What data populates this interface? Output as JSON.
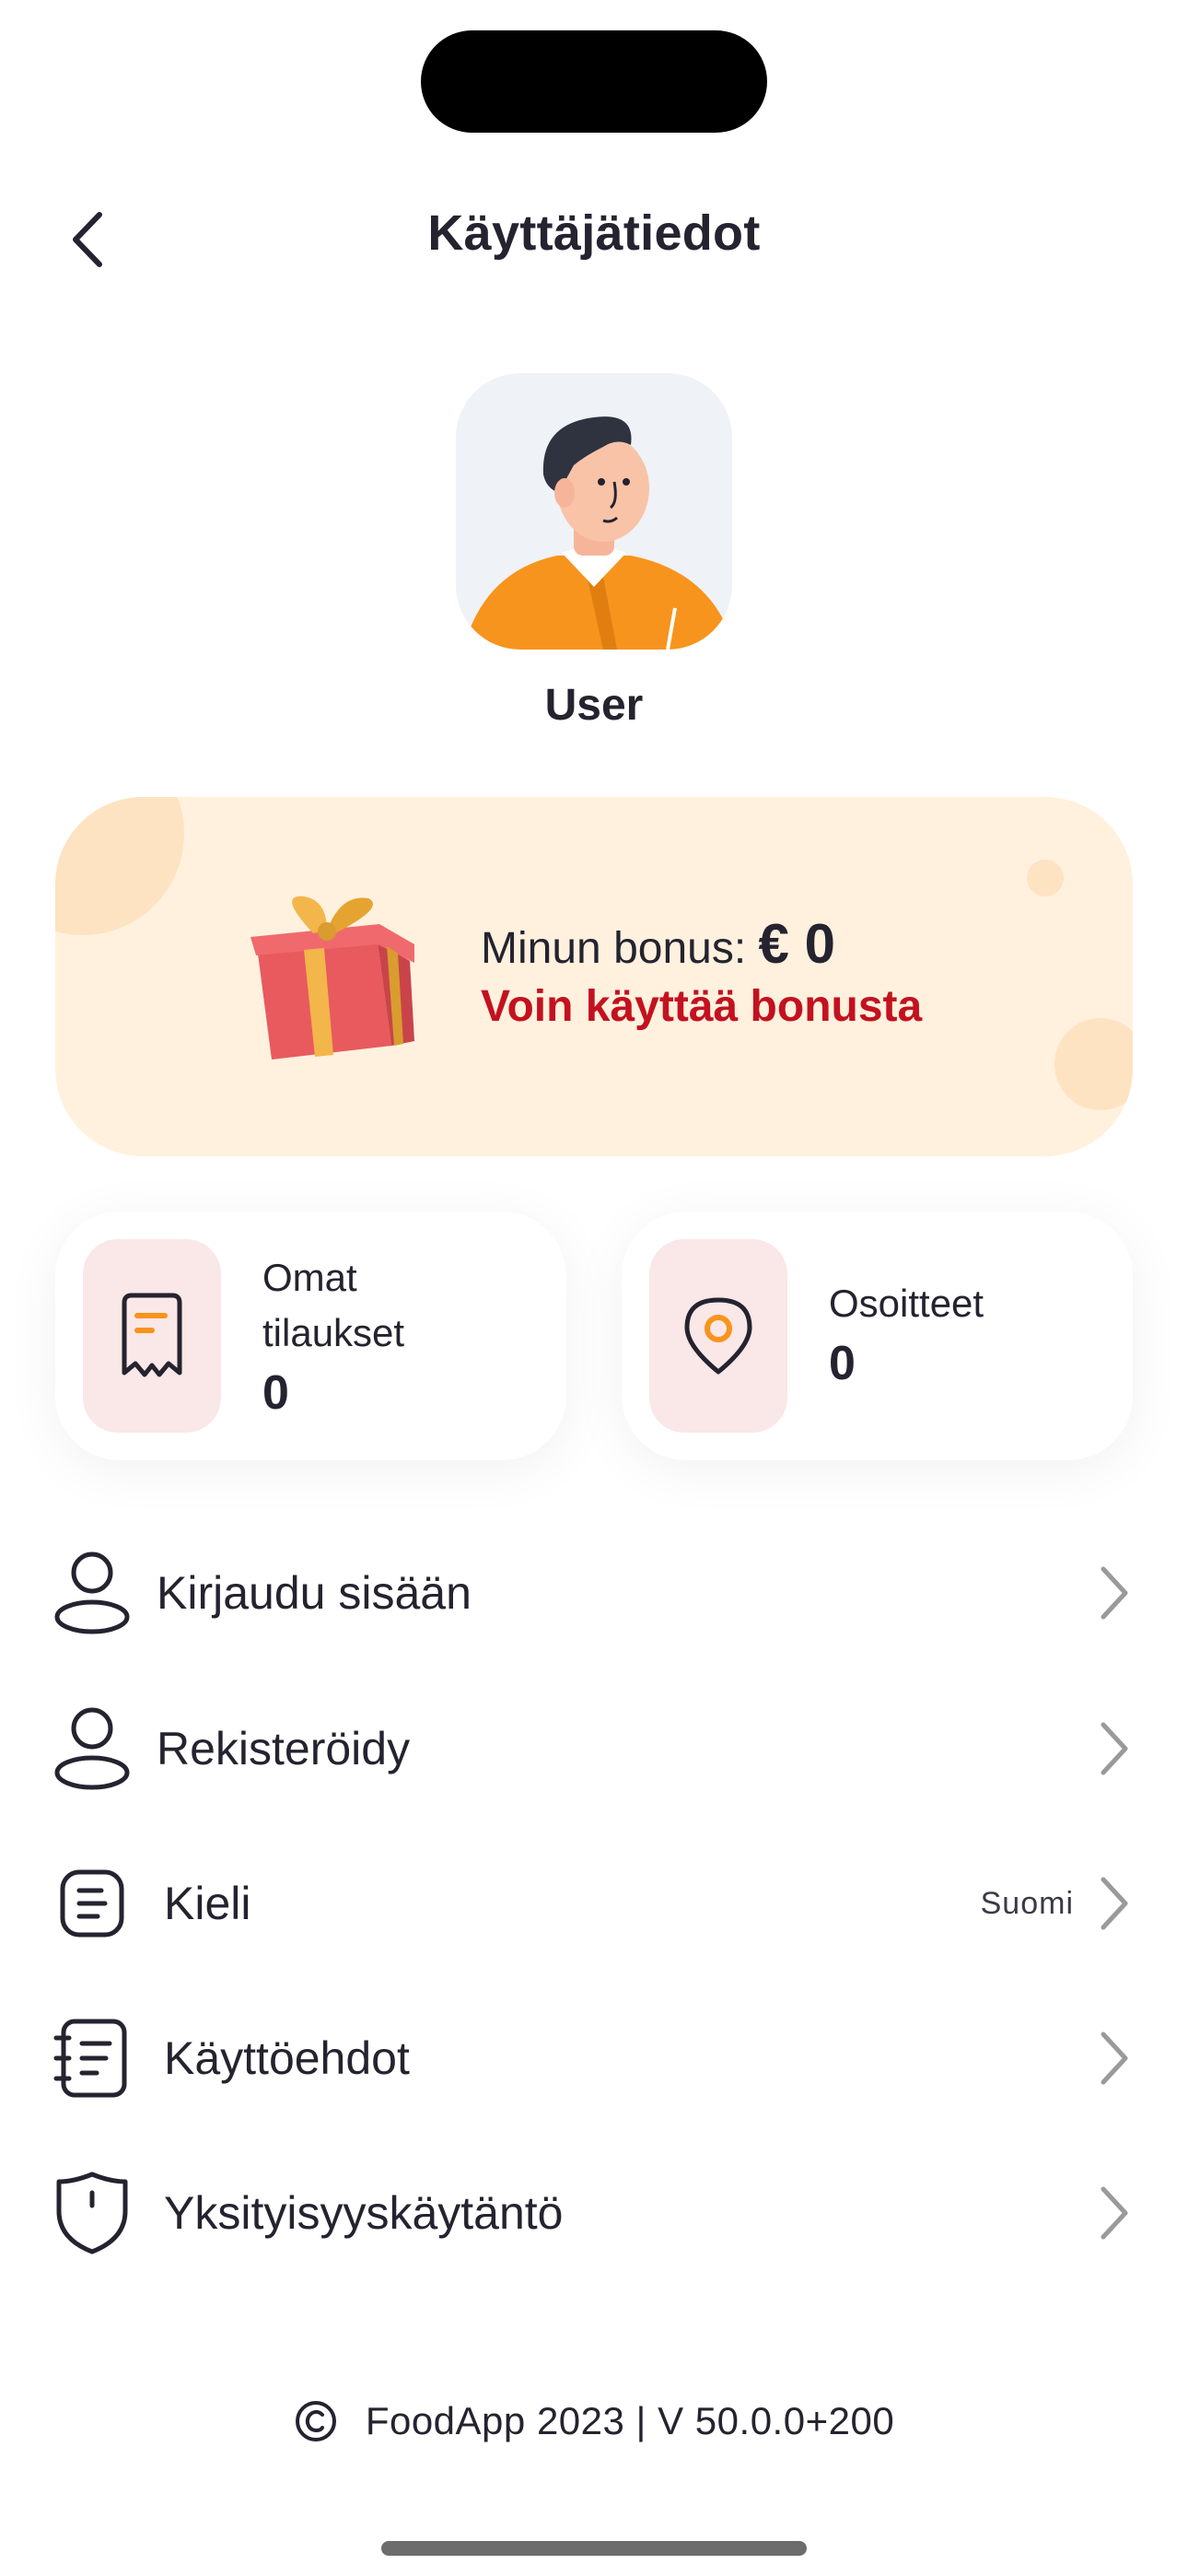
{
  "header": {
    "title": "Käyttäjätiedot"
  },
  "user": {
    "name": "User"
  },
  "bonus": {
    "label": "Minun bonus:",
    "amount": "€ 0",
    "action": "Voin käyttää bonusta"
  },
  "stats": {
    "orders": {
      "label": "Omat tilaukset",
      "value": "0"
    },
    "addresses": {
      "label": "Osoitteet",
      "value": "0"
    }
  },
  "menu": {
    "login": "Kirjaudu sisään",
    "register": "Rekisteröidy",
    "language": "Kieli",
    "language_value": "Suomi",
    "terms": "Käyttöehdot",
    "privacy": "Yksityisyyskäytäntö"
  },
  "footer": {
    "text": "FoodApp 2023 | V 50.0.0+200"
  },
  "colors": {
    "accent_orange": "#f7941d",
    "bonus_bg": "#fff1de",
    "bonus_action_red": "#c4111f",
    "icon_box_pink": "#fae7e7",
    "text_dark": "#24232f"
  }
}
